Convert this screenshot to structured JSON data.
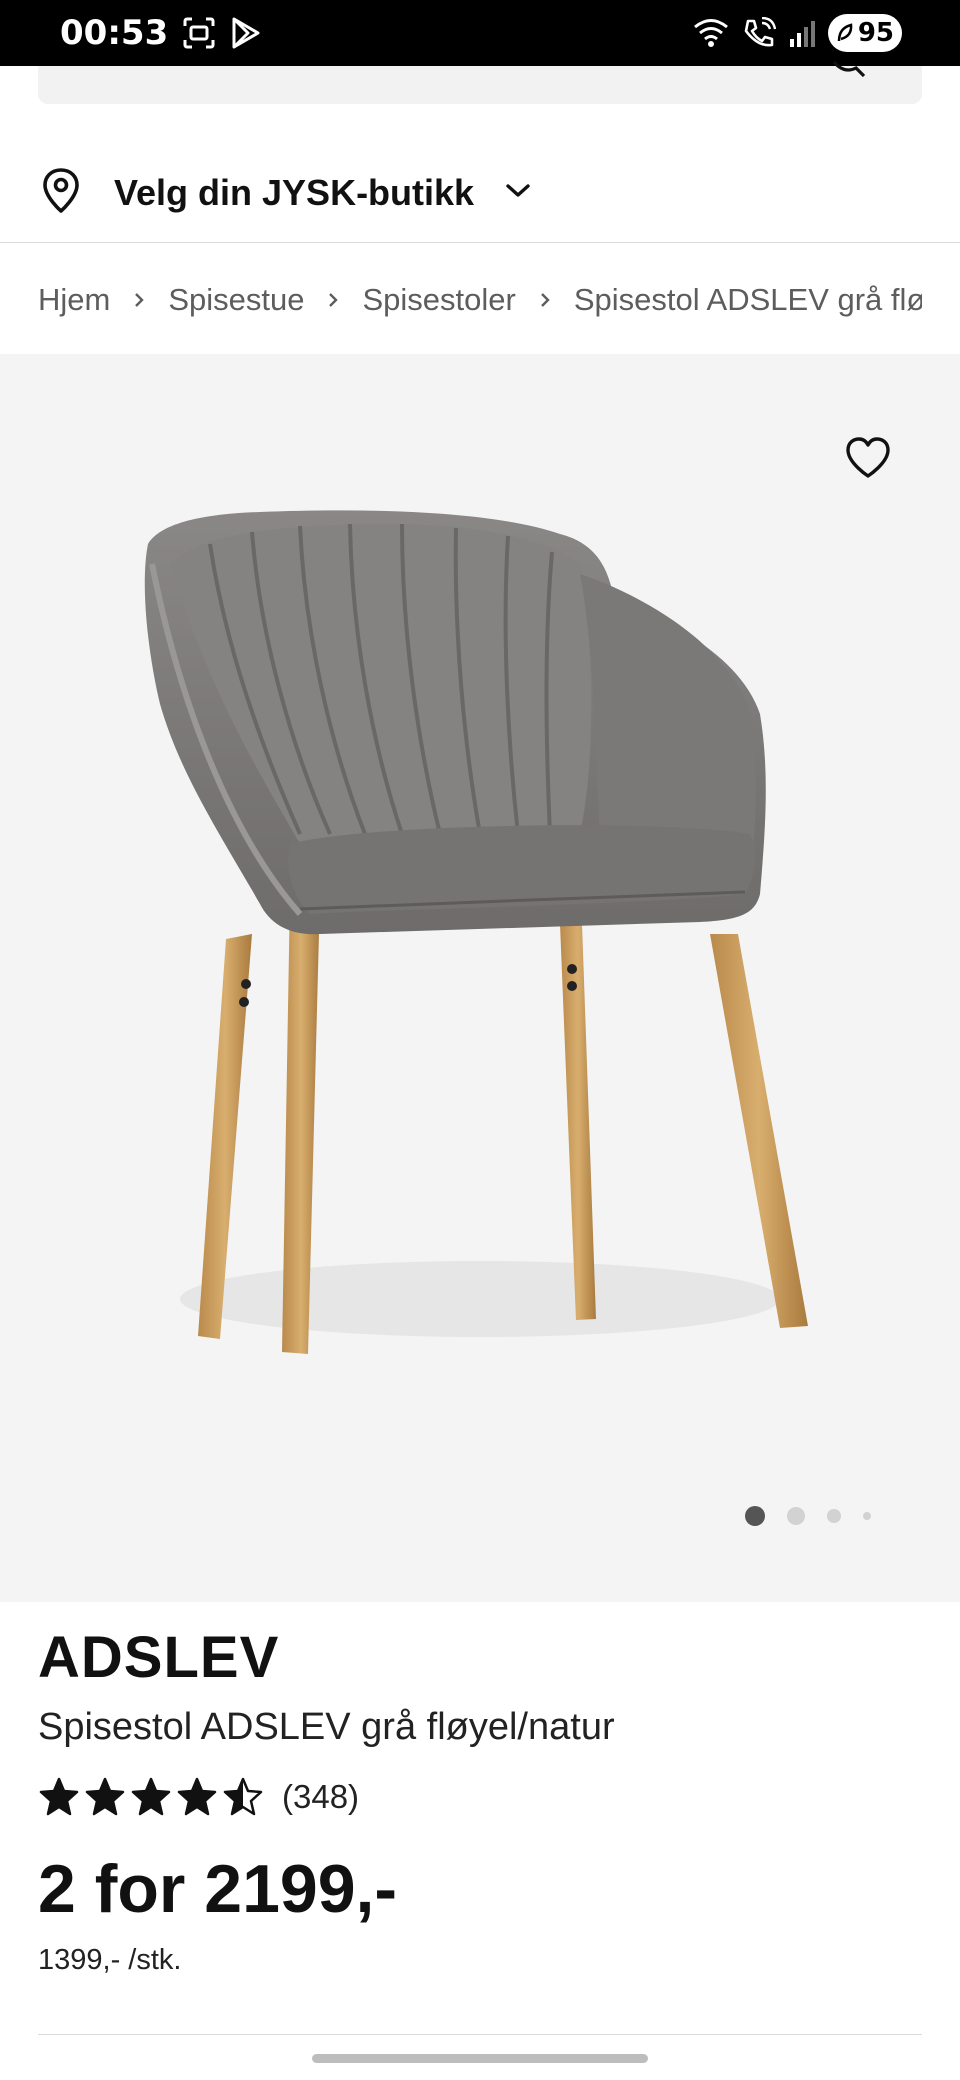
{
  "status_bar": {
    "time": "00:53",
    "battery": "95",
    "icons": [
      "screen-record-icon",
      "play-store-icon",
      "wifi-icon",
      "wifi-call-icon",
      "signal-icon",
      "battery-icon"
    ]
  },
  "store_picker": {
    "label": "Velg din JYSK-butikk",
    "icon": "location-pin-icon"
  },
  "breadcrumb": {
    "items": [
      "Hjem",
      "Spisestue",
      "Spisestoler",
      "Spisestol ADSLEV grå fløyel/natur"
    ]
  },
  "gallery": {
    "dot_count": 4,
    "active_dot": 0
  },
  "product": {
    "brand": "ADSLEV",
    "title": "Spisestol ADSLEV grå fløyel/natur",
    "rating": 4.5,
    "max_rating": 5,
    "review_count": "(348)",
    "price": "2 for 2199,-",
    "unit_price": "1399,- /stk."
  },
  "colors": {
    "gallery_bg": "#f4f4f4",
    "text": "#111111",
    "muted": "#5d5d5d",
    "status_bar": "#000000"
  }
}
